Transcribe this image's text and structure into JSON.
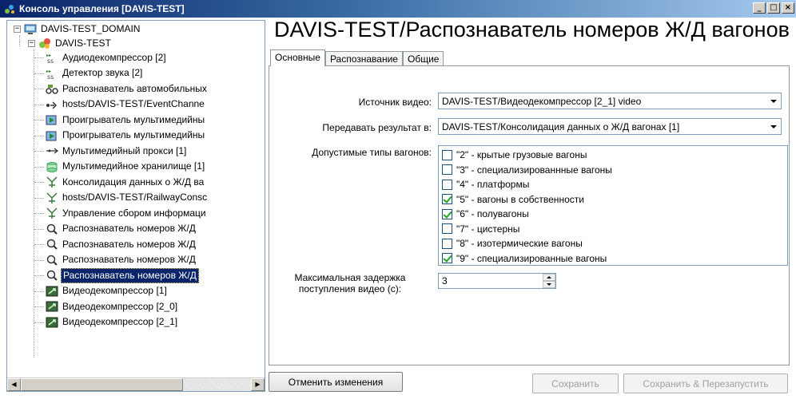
{
  "window": {
    "title": "Консоль управления [DAVIS-TEST]",
    "min_label": "_",
    "max_label": "□",
    "close_label": "×"
  },
  "tree": {
    "root": {
      "label": "DAVIS-TEST_DOMAIN",
      "expander": "−"
    },
    "server": {
      "label": "DAVIS-TEST",
      "expander": "−"
    },
    "items": [
      {
        "label": "Аудиодекомпрессор [2]",
        "icon": "audio-decompressor-icon"
      },
      {
        "label": "Детектор звука [2]",
        "icon": "sound-detector-icon"
      },
      {
        "label": "Распознаватель автомобильных",
        "icon": "car-recognizer-icon"
      },
      {
        "label": "hosts/DAVIS-TEST/EventChanne",
        "icon": "event-channel-icon"
      },
      {
        "label": "Проигрыватель мультимедийны",
        "icon": "media-player-icon"
      },
      {
        "label": "Проигрыватель мультимедийны",
        "icon": "media-player-icon"
      },
      {
        "label": "Мультимедийный прокси [1]",
        "icon": "media-proxy-icon"
      },
      {
        "label": "Мультимедийное хранилище [1]",
        "icon": "media-storage-icon"
      },
      {
        "label": "Консолидация данных о Ж/Д ва",
        "icon": "data-consolidation-icon"
      },
      {
        "label": "hosts/DAVIS-TEST/RailwayConsc",
        "icon": "data-consolidation-icon"
      },
      {
        "label": "Управление сбором информаци",
        "icon": "data-consolidation-icon"
      },
      {
        "label": "Распознаватель номеров Ж/Д",
        "icon": "magnifier-icon"
      },
      {
        "label": "Распознаватель номеров Ж/Д",
        "icon": "magnifier-icon"
      },
      {
        "label": "Распознаватель номеров Ж/Д",
        "icon": "magnifier-icon"
      },
      {
        "label": "Распознаватель номеров Ж/Д",
        "icon": "magnifier-icon",
        "selected": true
      },
      {
        "label": "Видеодекомпрессор [1]",
        "icon": "video-decompressor-icon"
      },
      {
        "label": "Видеодекомпрессор [2_0]",
        "icon": "video-decompressor-icon"
      },
      {
        "label": "Видеодекомпрессор [2_1]",
        "icon": "video-decompressor-icon"
      }
    ]
  },
  "main": {
    "title": "DAVIS-TEST/Распознаватель номеров Ж/Д вагонов",
    "tabs": [
      {
        "label": "Основные",
        "active": true
      },
      {
        "label": "Распознавание",
        "active": false
      },
      {
        "label": "Общие",
        "active": false
      }
    ],
    "form": {
      "video_source_label": "Источник видео:",
      "video_source_value": "DAVIS-TEST/Видеодекомпрессор [2_1] video",
      "send_result_label": "Передавать результат в:",
      "send_result_value": "DAVIS-TEST/Консолидация данных о Ж/Д вагонах [1]",
      "wagon_types_label": "Допустимые типы вагонов:",
      "wagon_types": [
        {
          "label": "\"2\" - крытые грузовые вагоны",
          "checked": false
        },
        {
          "label": "\"3\" - специализированнные вагоны",
          "checked": false
        },
        {
          "label": "\"4\" - платформы",
          "checked": false
        },
        {
          "label": "\"5\" - вагоны в собственности",
          "checked": true
        },
        {
          "label": "\"6\" - полувагоны",
          "checked": true
        },
        {
          "label": "\"7\" - цистерны",
          "checked": false
        },
        {
          "label": "\"8\" - изотермические вагоны",
          "checked": false
        },
        {
          "label": "\"9\" - специализированные вагоны",
          "checked": true
        }
      ],
      "max_delay_label_line1": "Максимальная задержка",
      "max_delay_label_line2": "поступления видео (с):",
      "max_delay_value": "3"
    },
    "buttons": {
      "cancel_changes": "Отменить изменения",
      "save": "Сохранить",
      "save_restart": "Сохранить & Перезапустить"
    }
  },
  "colors": {
    "selection": "#0a246a",
    "title_gradient_start": "#0a246a",
    "border": "#7f9db9"
  }
}
